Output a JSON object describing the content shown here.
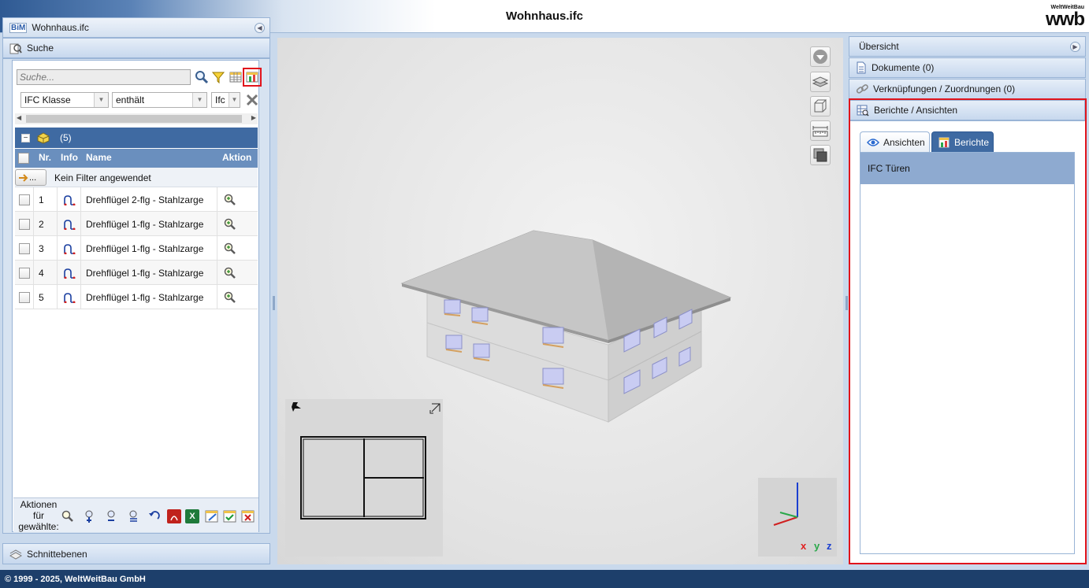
{
  "app": {
    "title": "Wohnhaus.ifc",
    "logo_small": "WeltWeitBau",
    "logo_big": "wwb"
  },
  "left_panel": {
    "title": "Wohnhaus.ifc",
    "bim_icon": "BiM"
  },
  "search": {
    "header": "Suche",
    "placeholder": "Suche...",
    "filter": {
      "field": "IFC Klasse",
      "operator": "enthält",
      "value": "Ifc"
    },
    "group": {
      "count": "(5)"
    },
    "columns": {
      "nr": "Nr.",
      "info": "Info",
      "name": "Name",
      "action": "Aktion"
    },
    "filter_row": {
      "button": "...",
      "text": "Kein Filter angewendet"
    },
    "rows": [
      {
        "nr": "1",
        "name": "Drehflügel 2-flg - Stahlzarge"
      },
      {
        "nr": "2",
        "name": "Drehflügel 1-flg - Stahlzarge"
      },
      {
        "nr": "3",
        "name": "Drehflügel 1-flg - Stahlzarge"
      },
      {
        "nr": "4",
        "name": "Drehflügel 1-flg - Stahlzarge"
      },
      {
        "nr": "5",
        "name": "Drehflügel 1-flg - Stahlzarge"
      }
    ],
    "actions_label_1": "Aktionen",
    "actions_label_2": "für",
    "actions_label_3": "gewählte:"
  },
  "schnittebenen": {
    "label": "Schnittebenen"
  },
  "axes": {
    "x": "x",
    "y": "y",
    "z": "z"
  },
  "right_panel": {
    "uebersicht": "Übersicht",
    "dokumente": "Dokumente (0)",
    "verknuepfungen": "Verknüpfungen / Zuordnungen (0)",
    "berichte": "Berichte / Ansichten",
    "tab_ansichten": "Ansichten",
    "tab_berichte": "Berichte",
    "list_items": [
      "IFC Türen"
    ]
  },
  "colors": {
    "accent": "#3f6aa2",
    "highlight": "#e1141c",
    "footer": "#1d3f6b"
  },
  "footer": {
    "text": "© 1999 - 2025, WeltWeitBau GmbH"
  }
}
